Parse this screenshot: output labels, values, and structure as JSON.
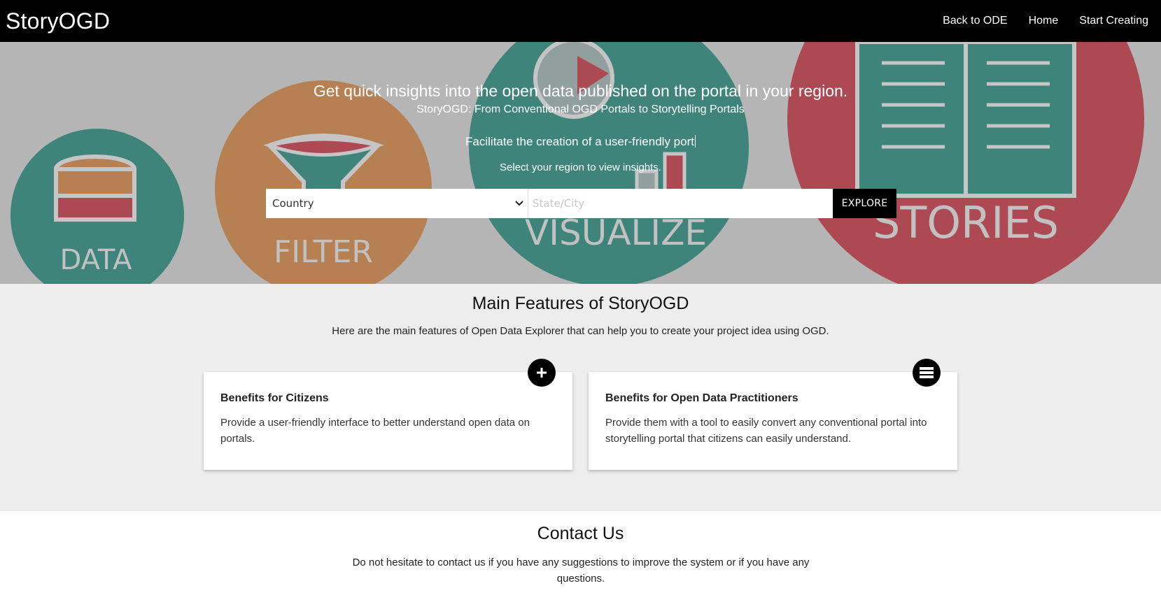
{
  "header": {
    "brand": "StoryOGD",
    "nav": [
      "Back to ODE",
      "Home",
      "Start Creating"
    ]
  },
  "hero": {
    "title": "Get quick insights into the open data published on the portal in your region.",
    "subtitle": "StoryOGD: From Conventional OGD Portals to Storytelling Portals",
    "typing_text": "Facilitate the creation of a user-friendly port",
    "select_hint": "Select your region to view insights.",
    "country_select_value": "Country",
    "state_placeholder": "State/City",
    "explore_label": "EXPLORE",
    "background_labels": [
      "DATA",
      "FILTER",
      "VISUALIZE",
      "STORIES"
    ]
  },
  "features": {
    "title": "Main Features of StoryOGD",
    "description": "Here are the main features of Open Data Explorer that can help you to create your project idea using OGD.",
    "cards": [
      {
        "title": "Benefits for Citizens",
        "text": "Provide a user-friendly interface to better understand open data on portals.",
        "icon": "plus-icon"
      },
      {
        "title": "Benefits for Open Data Practitioners",
        "text": "Provide them with a tool to easily convert any conventional portal into storytelling portal that citizens can easily understand.",
        "icon": "list-icon"
      }
    ]
  },
  "contact": {
    "title": "Contact Us",
    "description": "Do not hesitate to contact us if you have any suggestions to improve the system or if you have any questions."
  },
  "colors": {
    "header_bg": "#000000",
    "teal": "#1f8a7c",
    "orange": "#d9843f",
    "red": "#c8303f",
    "features_bg": "#ededed"
  }
}
